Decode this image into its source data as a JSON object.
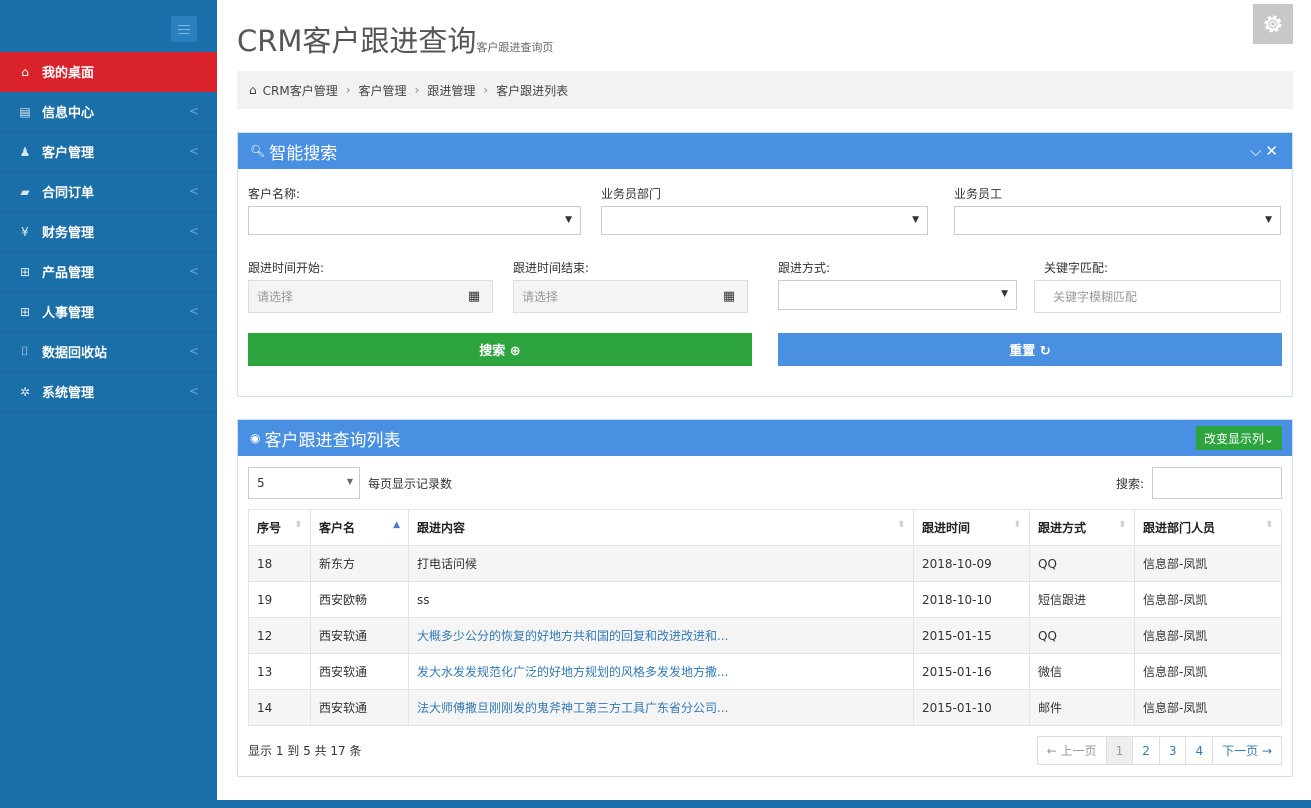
{
  "sidebar": {
    "items": [
      {
        "label": "我的桌面",
        "icon": "home-icon",
        "glyph": "⌂"
      },
      {
        "label": "信息中心",
        "icon": "calendar-icon",
        "glyph": "▤"
      },
      {
        "label": "客户管理",
        "icon": "person-icon",
        "glyph": "♟"
      },
      {
        "label": "合同订单",
        "icon": "book-icon",
        "glyph": "▰"
      },
      {
        "label": "财务管理",
        "icon": "yen-icon",
        "glyph": "¥"
      },
      {
        "label": "产品管理",
        "icon": "grid-icon",
        "glyph": "⊞"
      },
      {
        "label": "人事管理",
        "icon": "grid-icon",
        "glyph": "⊞"
      },
      {
        "label": "数据回收站",
        "icon": "trash-icon",
        "glyph": "⌷"
      },
      {
        "label": "系统管理",
        "icon": "gear-icon",
        "glyph": "✲"
      }
    ],
    "arrow": "<"
  },
  "header": {
    "title": "CRM客户跟进查询",
    "subtitle": "客户跟进查询页"
  },
  "breadcrumb": {
    "home_glyph": "⌂",
    "items": [
      "CRM客户管理",
      "客户管理",
      "跟进管理",
      "客户跟进列表"
    ],
    "sep": "›"
  },
  "search_panel": {
    "title": "智能搜索",
    "tools": "✓✕",
    "fields": {
      "customer_name_label": "客户名称:",
      "department_label": "业务员部门",
      "employee_label": "业务员工",
      "start_label": "跟进时间开始:",
      "end_label": "跟进时间结束:",
      "method_label": "跟进方式:",
      "keyword_label": "关键字匹配:",
      "start_placeholder": "请选择",
      "end_placeholder": "请选择",
      "keyword_placeholder": "关键字模糊匹配"
    },
    "search_button": "搜索 ⊕",
    "reset_button": "重置 ↻",
    "colors": {
      "search": "#2ea43f",
      "reset": "#4a90e2"
    }
  },
  "list_panel": {
    "title": "客户跟进查询列表",
    "columns_button": "改变显示列⌄",
    "page_size": "5",
    "page_size_label": "每页显示记录数",
    "search_label": "搜索:",
    "columns": [
      "序号",
      "客户名",
      "跟进内容",
      "跟进时间",
      "跟进方式",
      "跟进部门人员"
    ],
    "rows": [
      {
        "id": "18",
        "customer": "新东方",
        "content": "打电话问候",
        "time": "2018-10-09",
        "method": "QQ",
        "staff": "信息部-凤凯",
        "link": false
      },
      {
        "id": "19",
        "customer": "西安欧畅",
        "content": "ss",
        "time": "2018-10-10",
        "method": "短信跟进",
        "staff": "信息部-凤凯",
        "link": false
      },
      {
        "id": "12",
        "customer": "西安软通",
        "content": "大概多少公分的恢复的好地方共和国的回复和改进改进和...",
        "time": "2015-01-15",
        "method": "QQ",
        "staff": "信息部-凤凯",
        "link": true
      },
      {
        "id": "13",
        "customer": "西安软通",
        "content": "发大水发发规范化广泛的好地方规划的风格多发发地方撒...",
        "time": "2015-01-16",
        "method": "微信",
        "staff": "信息部-凤凯",
        "link": true
      },
      {
        "id": "14",
        "customer": "西安软通",
        "content": "法大师傅撒旦刚刚发的鬼斧神工第三方工具广东省分公司...",
        "time": "2015-01-10",
        "method": "邮件",
        "staff": "信息部-凤凯",
        "link": true
      }
    ],
    "summary": "显示 1 到 5 共 17 条",
    "pager": {
      "prev": "← 上一页",
      "pages": [
        "1",
        "2",
        "3",
        "4"
      ],
      "next": "下一页 →",
      "current": "1"
    }
  },
  "colors": {
    "sidebar": "#1b6fa8",
    "active": "#d9222a",
    "panel_head": "#4a90e2",
    "columns_button": "#2ea43f"
  }
}
